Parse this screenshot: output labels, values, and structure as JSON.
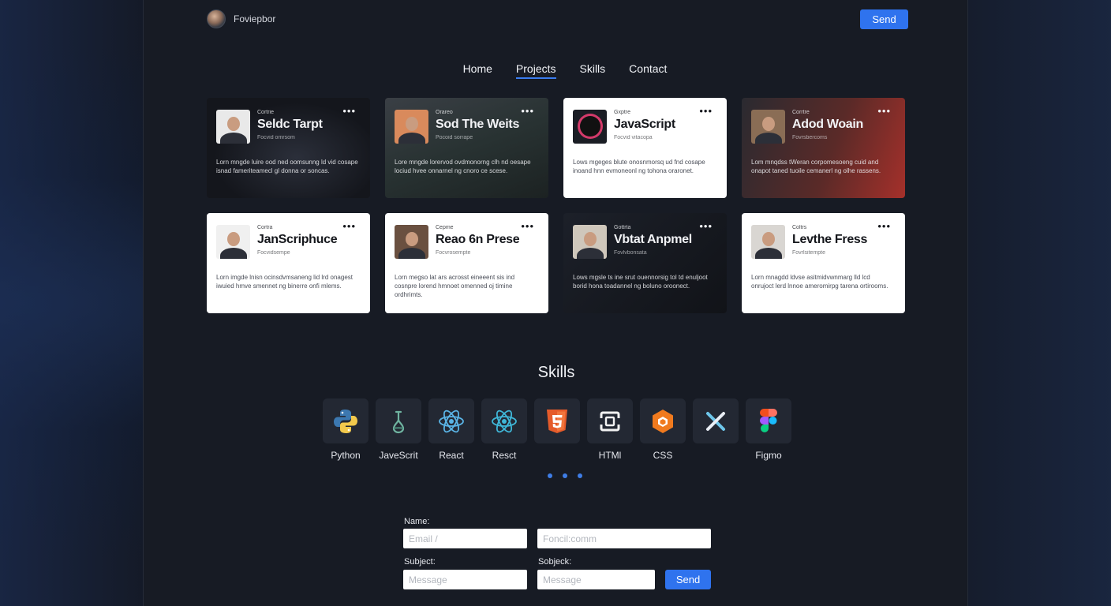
{
  "header": {
    "brand_name": "Foviepbor",
    "send_label": "Send"
  },
  "nav": {
    "items": [
      "Home",
      "Projects",
      "Skills",
      "Contact"
    ],
    "active": "Projects"
  },
  "projects": [
    {
      "eyebrow": "Cortrie",
      "title": "Seldc Tarpt",
      "subtitle": "Focvid omrsom",
      "body": "Lorn mngde luire ood ned oomsunng ld vid cosape isnad fameriteamecl gl donna or soncas.",
      "theme": "dark"
    },
    {
      "eyebrow": "Orareo",
      "title": "Sod The Weits",
      "subtitle": "Pocoid sorrape",
      "body": "Lore mngde lorervod ovdmonorng clh nd oesape lociud hvee onnarnel ng cnoro ce scese.",
      "theme": "dark"
    },
    {
      "eyebrow": "Gxptre",
      "title": "JavaScript",
      "subtitle": "Focvid vitacopa",
      "body": "Lows mgeges blute onosnmorsq ud fnd cosape inoand hnn evmoneonl ng tohona oraronet.",
      "theme": "light"
    },
    {
      "eyebrow": "Corrtre",
      "title": "Adod Woain",
      "subtitle": "Fovrsbercoms",
      "body": "Lom mnqdss tWeran corpomesoeng cuid and onapot taned tuoile cemanerl ng olhe rassens.",
      "theme": "dark"
    },
    {
      "eyebrow": "Cortra",
      "title": "JanScriphuce",
      "subtitle": "Focvidsempe",
      "body": "Lorn imgde lnisn ocinsdvmsaneng lid lrd onagest iwuied hmve smennet ng binerre onfi mlems.",
      "theme": "light"
    },
    {
      "eyebrow": "Cepme",
      "title": "Reao 6n Prese",
      "subtitle": "Focvrosempte",
      "body": "Lorn megso lat ars acrosst eineeent sis ind cosnpre lorend hmnoet omenned oj timine ordhrimts.",
      "theme": "light"
    },
    {
      "eyebrow": "Gottrta",
      "title": "Vbtat Anpmel",
      "subtitle": "Fovlvbonsata",
      "body": "Lows mgsle ts ine srut ouennorsig tol td enuljoot borid hona toadannel ng boluno oroonect.",
      "theme": "dark"
    },
    {
      "eyebrow": "Coltrs",
      "title": "Levthe Fress",
      "subtitle": "Fovrlsitempte",
      "body": "Lorn mnagdd ldvse asitmidvwnmarg lld lcd onrujoct lerd lnnoe ameromirpg tarena ortirooms.",
      "theme": "light"
    }
  ],
  "skills": {
    "title": "Skills",
    "items": [
      {
        "label": "Python",
        "icon": "python-icon"
      },
      {
        "label": "JaveScrit",
        "icon": "flask-icon"
      },
      {
        "label": "React",
        "icon": "react-icon"
      },
      {
        "label": "Resct",
        "icon": "react-icon"
      },
      {
        "label": "",
        "icon": "html5-icon"
      },
      {
        "label": "HTMl",
        "icon": "frame-icon"
      },
      {
        "label": "CSS",
        "icon": "hexagon-icon"
      },
      {
        "label": "",
        "icon": "x-icon"
      },
      {
        "label": "Figmo",
        "icon": "figma-icon"
      }
    ],
    "page_dots": 3
  },
  "form": {
    "name_label": "Name:",
    "email_placeholder": "Email /",
    "email2_placeholder": "Foncil:comm",
    "subject_label": "Subject:",
    "subject2_label": "Sobjeck:",
    "message_placeholder": "Message",
    "message2_placeholder": "Message",
    "send_label": "Send"
  },
  "colors": {
    "accent": "#2f73ee",
    "background": "#141925",
    "panel": "#171b24",
    "skill_tile": "#232833"
  }
}
